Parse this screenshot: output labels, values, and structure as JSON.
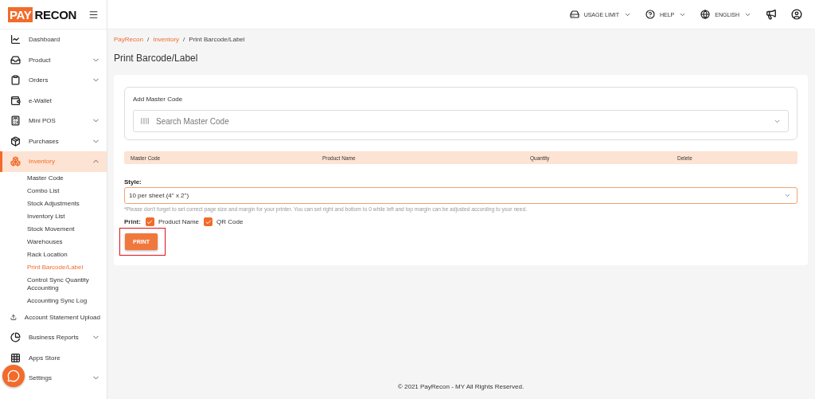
{
  "logo": {
    "part_1": "PAY",
    "part_2": "RECON"
  },
  "topbar": {
    "items": [
      {
        "kind": "dropdown",
        "label": "USAGE LIMIT"
      },
      {
        "kind": "dropdown",
        "label": "HELP"
      },
      {
        "kind": "dropdown",
        "label": "ENGLISH"
      },
      {
        "kind": "icon"
      },
      {
        "kind": "icon"
      }
    ]
  },
  "sidebar": {
    "items": [
      {
        "label": "Dashboard",
        "selected": false
      },
      {
        "label": "Product",
        "selected": false,
        "expanded": false
      },
      {
        "label": "Orders",
        "selected": false,
        "expanded": false
      },
      {
        "label": "e-Wallet",
        "selected": false
      },
      {
        "label": "Mini POS",
        "selected": false,
        "expanded": false
      },
      {
        "label": "Purchases",
        "selected": false,
        "expanded": false
      },
      {
        "label": "Inventory",
        "selected": true,
        "expanded": true,
        "children": [
          {
            "label": "Master Code",
            "selected": false
          },
          {
            "label": "Combo List",
            "selected": false
          },
          {
            "label": "Stock Adjustments",
            "selected": false
          },
          {
            "label": "Inventory List",
            "selected": false
          },
          {
            "label": "Stock Movement",
            "selected": false
          },
          {
            "label": "Warehouses",
            "selected": false
          },
          {
            "label": "Rack Location",
            "selected": false
          },
          {
            "label": "Print Barcode/Label",
            "selected": true
          },
          {
            "label": "Control Sync Quantity Accounting",
            "selected": false
          },
          {
            "label": "Accounting Sync Log",
            "selected": false
          }
        ]
      },
      {
        "label": "Account Statement Upload",
        "selected": false
      },
      {
        "label": "Business Reports",
        "selected": false,
        "expanded": false
      },
      {
        "label": "Apps Store",
        "selected": false
      },
      {
        "label": "Settings",
        "selected": false,
        "expanded": false
      }
    ]
  },
  "breadcrumb": [
    {
      "kind": "link",
      "label": "PayRecon"
    },
    {
      "kind": "separator",
      "label": "/"
    },
    {
      "kind": "link",
      "label": "Inventory"
    },
    {
      "kind": "separator",
      "label": "/"
    },
    {
      "kind": "current",
      "label": "Print Barcode/Label"
    }
  ],
  "page_title": "Print Barcode/Label",
  "master_code": {
    "label": "Add Master Code",
    "placeholder": "Search Master Code"
  },
  "table": {
    "columns": [
      "Master Code",
      "Product Name",
      "Quantity",
      "Delete"
    ]
  },
  "style": {
    "label": "Style:",
    "value": "10 per sheet (4\" x 2\")",
    "note": "*Please don't forget to set correct page size and margin for your printer. You can set right and bottom to 0 while left and top margin can be adjusted according to your need."
  },
  "print_options": {
    "label": "Print:",
    "options": [
      {
        "label": "Product Name",
        "checked": true
      },
      {
        "label": "QR Code",
        "checked": true
      }
    ]
  },
  "print_button": {
    "label": "PRINT",
    "highlighted": true
  },
  "footer": "© 2021 PayRecon - MY All Rights Reserved."
}
